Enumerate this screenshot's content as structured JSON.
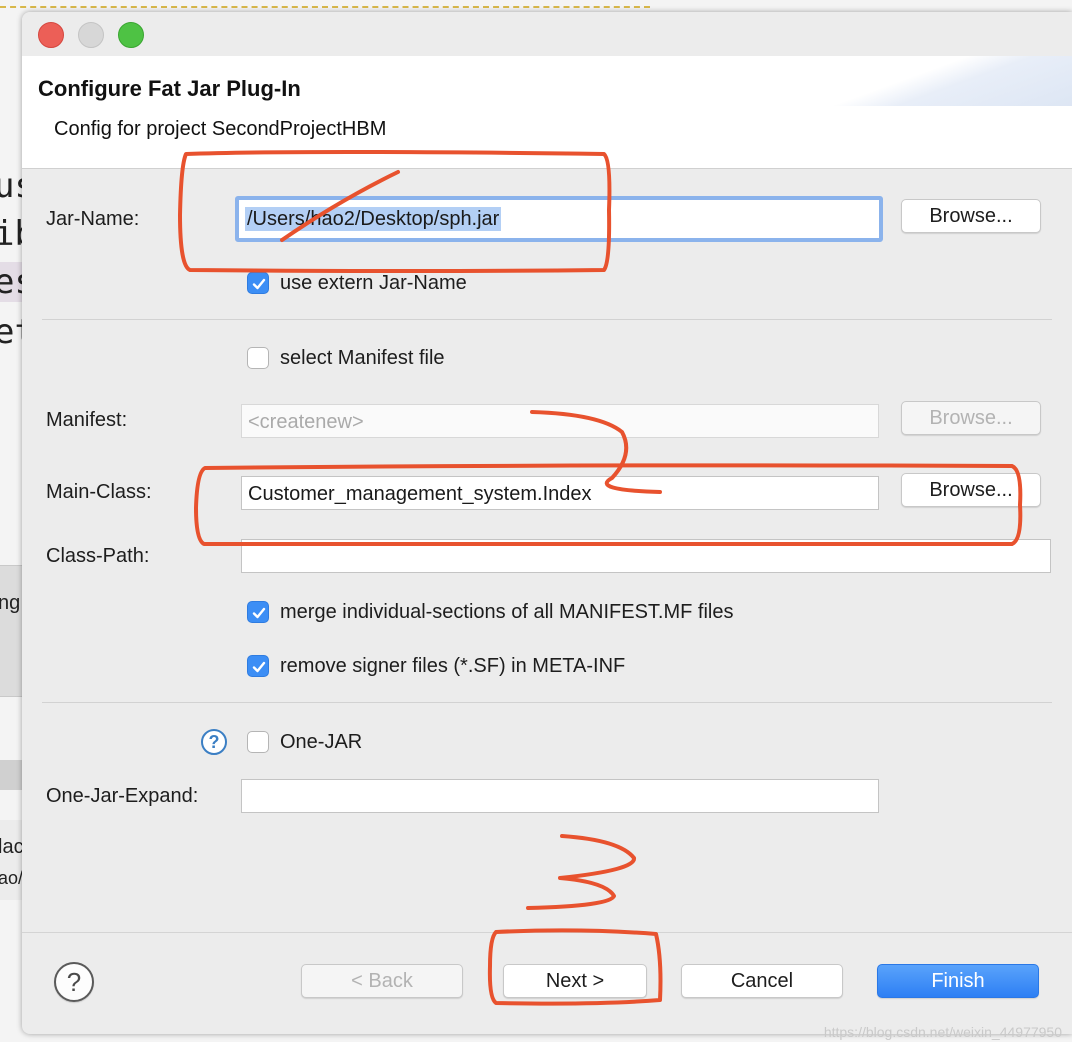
{
  "background": {
    "code_fragments": [
      "us",
      "ib",
      "es",
      "et"
    ],
    "side_fragments": [
      "ng",
      "lac",
      "ao/"
    ]
  },
  "dialog": {
    "title": "Configure Fat Jar Plug-In",
    "subtitle": "Config for project SecondProjectHBM"
  },
  "form": {
    "jar_name": {
      "label": "Jar-Name:",
      "value": "/Users/hao2/Desktop/sph.jar",
      "browse_label": "Browse..."
    },
    "use_extern_jar_name": {
      "label": "use extern Jar-Name",
      "checked": true
    },
    "select_manifest": {
      "label": "select Manifest file",
      "checked": false
    },
    "manifest": {
      "label": "Manifest:",
      "placeholder": "<createnew>",
      "browse_label": "Browse...",
      "enabled": false
    },
    "main_class": {
      "label": "Main-Class:",
      "value": "Customer_management_system.Index",
      "browse_label": "Browse..."
    },
    "class_path": {
      "label": "Class-Path:",
      "value": ""
    },
    "merge_sections": {
      "label": "merge individual-sections of all MANIFEST.MF files",
      "checked": true
    },
    "remove_signer": {
      "label": "remove signer files (*.SF) in META-INF",
      "checked": true
    },
    "one_jar": {
      "label": "One-JAR",
      "checked": false,
      "help_icon": "?"
    },
    "one_jar_expand": {
      "label": "One-Jar-Expand:",
      "value": ""
    }
  },
  "footer": {
    "help_icon": "?",
    "back_label": "< Back",
    "next_label": "Next >",
    "cancel_label": "Cancel",
    "finish_label": "Finish"
  },
  "annotations": {
    "color": "#e8522e",
    "numbers": [
      "1",
      "2",
      "3"
    ]
  },
  "watermark": "https://blog.csdn.net/weixin_44977950"
}
